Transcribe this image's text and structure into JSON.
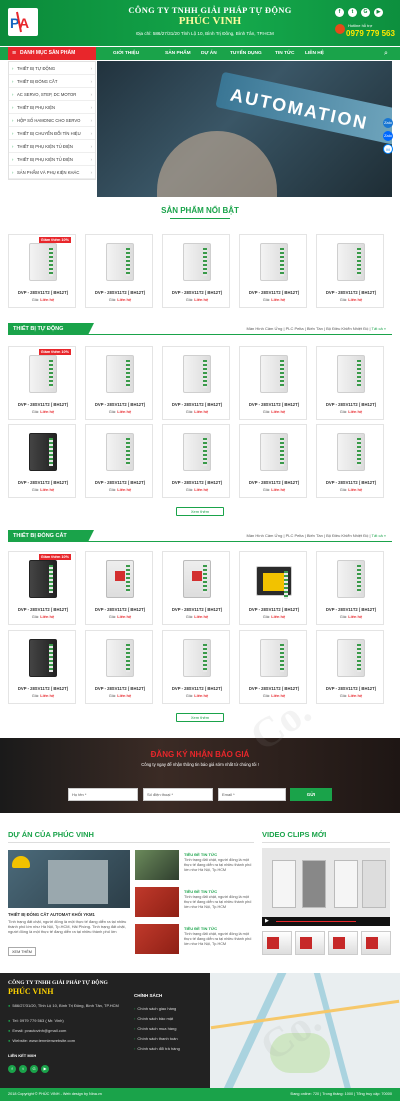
{
  "header": {
    "logo_text": "PVA",
    "company_name": "CÔNG TY TNHH GIẢI PHÁP TỰ ĐỘNG",
    "company_brand": "PHÚC VINH",
    "address": "Địa chỉ: 586/27/31/20 Tỉnh Lộ 10, Bình Trị Đông, Bình Tân, TP.HCM",
    "social": [
      "f",
      "t",
      "G",
      "▶"
    ],
    "hotline_label": "Hotline hỗ trợ",
    "hotline_number": "0979 779 563"
  },
  "nav": {
    "category_label": "DANH MỤC SẢN PHẨM",
    "items": [
      "GIỚI THIỆU",
      "SẢN PHẨM",
      "DỰ ÁN",
      "TUYỂN DỤNG",
      "TIN TỨC",
      "LIÊN HỆ"
    ]
  },
  "sidebar": {
    "items": [
      "THIẾT BỊ TỰ ĐỘNG",
      "THIẾT BỊ ĐÓNG CẮT",
      "AC SERVO, STEP, DC MOTOR",
      "THIẾT BỊ PHỤ KIỆN",
      "HỘP SỐ HAMONIC CHO SERVO",
      "THIẾT BỊ CHUYỂN ĐỔI TÍN HIỆU",
      "THIẾT BỊ PHỤ KIỆN TỦ ĐIỆN",
      "THIẾT BỊ PHỤ KIỆN TỦ ĐIỆN",
      "SẢN PHẨM VÀ PHỤ KIỆN KHÁC"
    ]
  },
  "banner": {
    "word": "AUTOMATION"
  },
  "float_buttons": [
    "Zalo",
    "Zalo",
    "M"
  ],
  "featured": {
    "title": "SẢN PHẨM NỔI BẬT",
    "products": [
      {
        "name": "DVP - 28SV11T2 ( BH12T)",
        "price_label": "Giá:",
        "price": "Liên hệ",
        "badge": "Giảm thêm 10%"
      },
      {
        "name": "DVP - 28SV11T2 ( BH12T)",
        "price_label": "Giá:",
        "price": "Liên hệ"
      },
      {
        "name": "DVP - 28SV11T2 ( BH12T)",
        "price_label": "Giá:",
        "price": "Liên hệ"
      },
      {
        "name": "DVP - 28SV11T2 ( BH12T)",
        "price_label": "Giá:",
        "price": "Liên hệ"
      },
      {
        "name": "DVP - 28SV11T2 ( BH12T)",
        "price_label": "Giá:",
        "price": "Liên hệ"
      }
    ]
  },
  "cat1": {
    "title": "THIẾT BỊ TỰ ĐỘNG",
    "links": "Màn Hình Cảm Ứng | PLC Pelta | Biến Tần | Bộ Điều Khiển Nhiệt Độ |",
    "more": "Tất cả »",
    "more_btn": "Xem thêm",
    "row1": [
      {
        "name": "DVP - 28SV11T2 ( BH12T)",
        "price_label": "Giá:",
        "price": "Liên hệ",
        "badge": "Giảm thêm 10%"
      },
      {
        "name": "DVP - 28SV11T2 ( BH12T)",
        "price_label": "Giá:",
        "price": "Liên hệ"
      },
      {
        "name": "DVP - 28SV11T2 ( BH12T)",
        "price_label": "Giá:",
        "price": "Liên hệ"
      },
      {
        "name": "DVP - 28SV11T2 ( BH12T)",
        "price_label": "Giá:",
        "price": "Liên hệ"
      },
      {
        "name": "DVP - 28SV11T2 ( BH12T)",
        "price_label": "Giá:",
        "price": "Liên hệ"
      }
    ],
    "row2": [
      {
        "name": "DVP - 28SV11T2 ( BH12T)",
        "price_label": "Giá:",
        "price": "Liên hệ"
      },
      {
        "name": "DVP - 28SV11T2 ( BH12T)",
        "price_label": "Giá:",
        "price": "Liên hệ"
      },
      {
        "name": "DVP - 28SV11T2 ( BH12T)",
        "price_label": "Giá:",
        "price": "Liên hệ"
      },
      {
        "name": "DVP - 28SV11T2 ( BH12T)",
        "price_label": "Giá:",
        "price": "Liên hệ"
      },
      {
        "name": "DVP - 28SV11T2 ( BH12T)",
        "price_label": "Giá:",
        "price": "Liên hệ"
      }
    ]
  },
  "cat2": {
    "title": "THIẾT BỊ ĐÓNG CẮT",
    "links": "Màn Hình Cảm Ứng | PLC Pelta | Biến Tần | Bộ Điều Khiển Nhiệt Độ |",
    "more": "Tất cả »",
    "more_btn": "Xem thêm",
    "row1": [
      {
        "name": "DVP - 28SV11T2 ( BH12T)",
        "price_label": "Giá:",
        "price": "Liên hệ",
        "badge": "Giảm thêm 10%"
      },
      {
        "name": "DVP - 28SV11T2 ( BH12T)",
        "price_label": "Giá:",
        "price": "Liên hệ"
      },
      {
        "name": "DVP - 28SV11T2 ( BH12T)",
        "price_label": "Giá:",
        "price": "Liên hệ"
      },
      {
        "name": "DVP - 28SV11T2 ( BH12T)",
        "price_label": "Giá:",
        "price": "Liên hệ"
      },
      {
        "name": "DVP - 28SV11T2 ( BH12T)",
        "price_label": "Giá:",
        "price": "Liên hệ"
      }
    ],
    "row2": [
      {
        "name": "DVP - 28SV11T2 ( BH12T)",
        "price_label": "Giá:",
        "price": "Liên hệ"
      },
      {
        "name": "DVP - 28SV11T2 ( BH12T)",
        "price_label": "Giá:",
        "price": "Liên hệ"
      },
      {
        "name": "DVP - 28SV11T2 ( BH12T)",
        "price_label": "Giá:",
        "price": "Liên hệ"
      },
      {
        "name": "DVP - 28SV11T2 ( BH12T)",
        "price_label": "Giá:",
        "price": "Liên hệ"
      },
      {
        "name": "DVP - 28SV11T2 ( BH12T)",
        "price_label": "Giá:",
        "price": "Liên hệ"
      }
    ]
  },
  "quote": {
    "title": "ĐĂNG KÝ NHẬN BÁO GIÁ",
    "subtitle": "Công ty ngay để nhận thông tin báo giá sớm nhất từ chúng tôi !",
    "name_ph": "Họ tên *",
    "phone_ph": "Số điện thoại *",
    "email_ph": "Email *",
    "submit": "GỬI"
  },
  "projects": {
    "title": "DỰ ÁN CỦA PHÚC VINH",
    "main_title": "THIẾT BỊ ĐÓNG CẮT AUTOMAT KHỐI YKM1",
    "main_desc": "Tình trạng đất chật, người đông là một thực tế đang diễn ra tại nhiều thành phố lớn như Hà Nội, Tp.HCM, Hải Phòng. Tình trạng đất chật, người đông là một thực tế đang diễn ra tại nhiều thành phố lớn",
    "main_btn": "XEM THÊM",
    "items": [
      {
        "title": "TIÊU ĐỀ TIN TỨC",
        "desc": "Tình trạng đất chật, người đông là một thực tế đang diễn ra tại nhiều thành phố lớn như Hà Nội, Tp.HCM"
      },
      {
        "title": "TIÊU ĐỀ TIN TỨC",
        "desc": "Tình trạng đất chật, người đông là một thực tế đang diễn ra tại nhiều thành phố lớn như Hà Nội, Tp.HCM"
      },
      {
        "title": "TIÊU ĐỀ TIN TỨC",
        "desc": "Tình trạng đất chật, người đông là một thực tế đang diễn ra tại nhiều thành phố lớn như Hà Nội, Tp.HCM"
      }
    ]
  },
  "videos": {
    "title": "VIDEO CLIPS MỚI"
  },
  "footer": {
    "company": "CÔNG TY TNHH GIẢI PHÁP TỰ ĐỘNG",
    "brand": "PHÚC VINH",
    "address": "586/27/31/20, Tỉnh Lộ 10, Bình Trị Đông, Bình Tân, TP.HCM",
    "phone": "Tel: 0979 779 563 ( Mr. Vinh)",
    "email": "Email: pvautovinh@gmail.com",
    "website": "Website: www.tenmienwebsite.com",
    "connect": "LIÊN KẾT MXH",
    "policy_title": "CHÍNH SÁCH",
    "policies": [
      "Chính sách giao hàng",
      "Chính sách bảo mật",
      "Chính sách mua hàng",
      "Chính sách thanh toán",
      "Chính sách đổi trả hàng"
    ],
    "copyright": "2018 Copyright © PHÚC VINH - Web design by Nina.vn",
    "stats": "Đang online: 720 | Trong tháng: 1000 | Tổng truy cập: 70000"
  }
}
